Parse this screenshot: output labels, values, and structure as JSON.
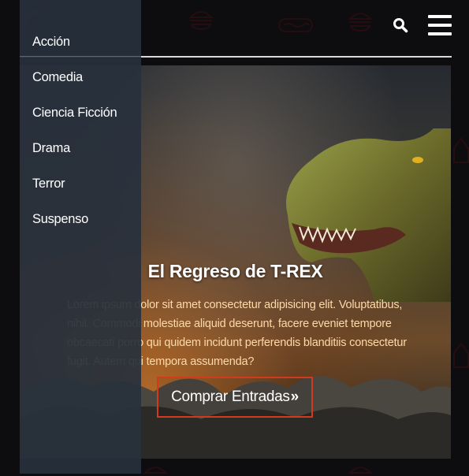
{
  "colors": {
    "background": "#0d0d10",
    "sidebar": "#28303c",
    "accent": "#d23a1e",
    "description_text": "#ffd9a8"
  },
  "header": {
    "search_icon": "search-icon",
    "menu_icon": "hamburger-icon"
  },
  "sidebar": {
    "items": [
      {
        "label": "Acción"
      },
      {
        "label": "Comedia"
      },
      {
        "label": "Ciencia Ficción"
      },
      {
        "label": "Drama"
      },
      {
        "label": "Terror"
      },
      {
        "label": "Suspenso"
      }
    ]
  },
  "hero": {
    "title": "El Regreso de T-REX",
    "description": "Lorem ipsum dolor sit amet consectetur adipisicing elit. Voluptatibus, nihil. Commodi molestiae aliquid deserunt, facere eveniet tempore obcaecati porro qui quidem incidunt perferendis blanditiis consectetur fugit. Autem qui tempora assumenda?",
    "button_label": "Comprar Entradas",
    "button_icon": "double-chevron-right-icon"
  }
}
